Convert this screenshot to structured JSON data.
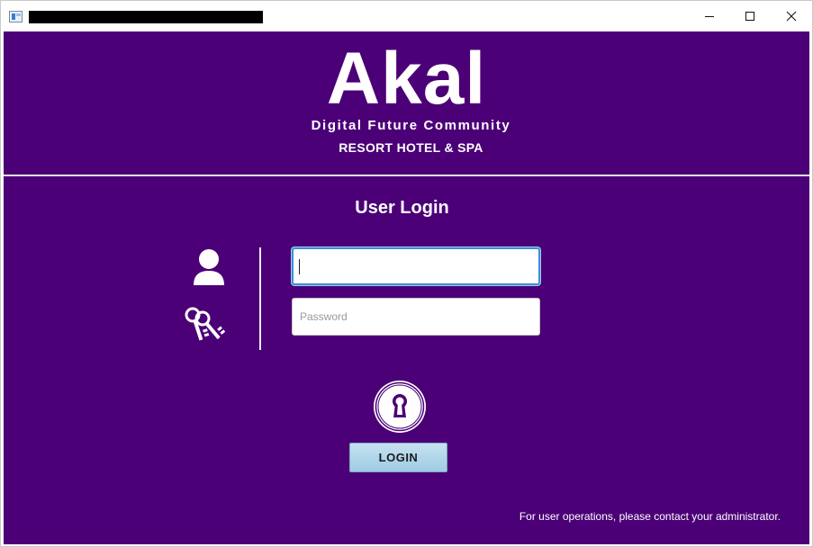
{
  "window": {
    "controls": {
      "minimize_icon": "minimize-icon",
      "maximize_icon": "maximize-icon",
      "close_icon": "close-icon"
    }
  },
  "brand": {
    "name": "Akal",
    "tagline": "Digital Future Community",
    "subtitle": "RESORT HOTEL & SPA"
  },
  "login": {
    "title": "User Login",
    "username": {
      "value": "",
      "placeholder": ""
    },
    "password": {
      "value": "",
      "placeholder": "Password"
    },
    "button_label": "LOGIN"
  },
  "footer": {
    "note": "For user operations, please contact your administrator."
  },
  "colors": {
    "background": "#4b0077",
    "text": "#ffffff",
    "focus_border": "#3c8fd8",
    "button_top": "#c6e2f1",
    "button_bottom": "#9ecbe3"
  },
  "icons": [
    "user-icon",
    "keys-icon",
    "keyhole-icon"
  ]
}
